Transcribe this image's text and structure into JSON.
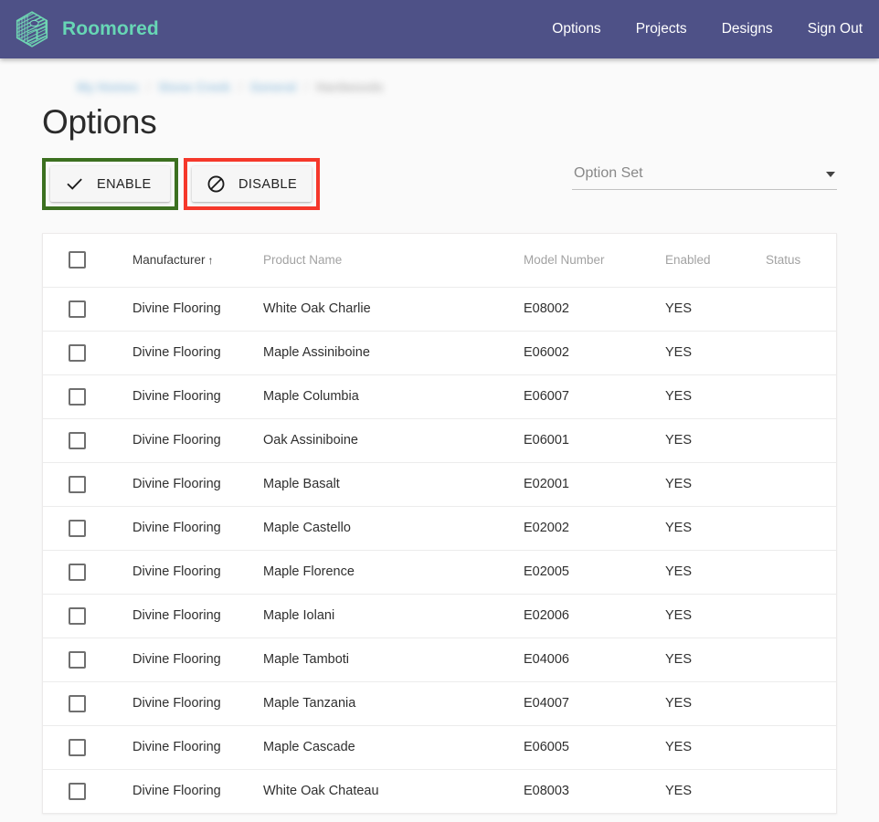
{
  "header": {
    "brand": "Roomored",
    "logo_icon": "hexagon-logo-icon",
    "nav": [
      {
        "label": "Options"
      },
      {
        "label": "Projects"
      },
      {
        "label": "Designs"
      },
      {
        "label": "Sign Out"
      }
    ],
    "background_color": "#4e5187",
    "brand_color": "#67d6b5"
  },
  "breadcrumb": {
    "blurred": true,
    "items": [
      {
        "label": "My Homes",
        "current": false
      },
      {
        "label": "Stone Creek",
        "current": false
      },
      {
        "label": "General",
        "current": false
      },
      {
        "label": "Hardwoods",
        "current": true
      }
    ],
    "separator": "/"
  },
  "page": {
    "title": "Options"
  },
  "toolbar": {
    "enable": {
      "label": "ENABLE",
      "icon": "check-icon",
      "highlight_color": "#3c7020"
    },
    "disable": {
      "label": "DISABLE",
      "icon": "block-icon",
      "highlight_color": "#f5382b"
    },
    "option_set": {
      "label": "Option Set",
      "value": "",
      "placeholder": "Option Set",
      "icon": "chevron-down-icon"
    }
  },
  "table": {
    "columns": [
      {
        "key": "select",
        "label": ""
      },
      {
        "key": "manufacturer",
        "label": "Manufacturer",
        "sorted": true,
        "sort_direction": "asc",
        "sort_glyph": "↑"
      },
      {
        "key": "product_name",
        "label": "Product Name"
      },
      {
        "key": "model_number",
        "label": "Model Number"
      },
      {
        "key": "enabled",
        "label": "Enabled"
      },
      {
        "key": "status",
        "label": "Status"
      }
    ],
    "select_all_checked": false,
    "rows": [
      {
        "checked": false,
        "manufacturer": "Divine Flooring",
        "product_name": "White Oak Charlie",
        "model_number": "E08002",
        "enabled": "YES",
        "status": ""
      },
      {
        "checked": false,
        "manufacturer": "Divine Flooring",
        "product_name": "Maple Assiniboine",
        "model_number": "E06002",
        "enabled": "YES",
        "status": ""
      },
      {
        "checked": false,
        "manufacturer": "Divine Flooring",
        "product_name": "Maple Columbia",
        "model_number": "E06007",
        "enabled": "YES",
        "status": ""
      },
      {
        "checked": false,
        "manufacturer": "Divine Flooring",
        "product_name": "Oak Assiniboine",
        "model_number": "E06001",
        "enabled": "YES",
        "status": ""
      },
      {
        "checked": false,
        "manufacturer": "Divine Flooring",
        "product_name": "Maple Basalt",
        "model_number": "E02001",
        "enabled": "YES",
        "status": ""
      },
      {
        "checked": false,
        "manufacturer": "Divine Flooring",
        "product_name": "Maple Castello",
        "model_number": "E02002",
        "enabled": "YES",
        "status": ""
      },
      {
        "checked": false,
        "manufacturer": "Divine Flooring",
        "product_name": "Maple Florence",
        "model_number": "E02005",
        "enabled": "YES",
        "status": ""
      },
      {
        "checked": false,
        "manufacturer": "Divine Flooring",
        "product_name": "Maple Iolani",
        "model_number": "E02006",
        "enabled": "YES",
        "status": ""
      },
      {
        "checked": false,
        "manufacturer": "Divine Flooring",
        "product_name": "Maple Tamboti",
        "model_number": "E04006",
        "enabled": "YES",
        "status": ""
      },
      {
        "checked": false,
        "manufacturer": "Divine Flooring",
        "product_name": "Maple Tanzania",
        "model_number": "E04007",
        "enabled": "YES",
        "status": ""
      },
      {
        "checked": false,
        "manufacturer": "Divine Flooring",
        "product_name": "Maple Cascade",
        "model_number": "E06005",
        "enabled": "YES",
        "status": ""
      },
      {
        "checked": false,
        "manufacturer": "Divine Flooring",
        "product_name": "White Oak Chateau",
        "model_number": "E08003",
        "enabled": "YES",
        "status": ""
      }
    ]
  }
}
